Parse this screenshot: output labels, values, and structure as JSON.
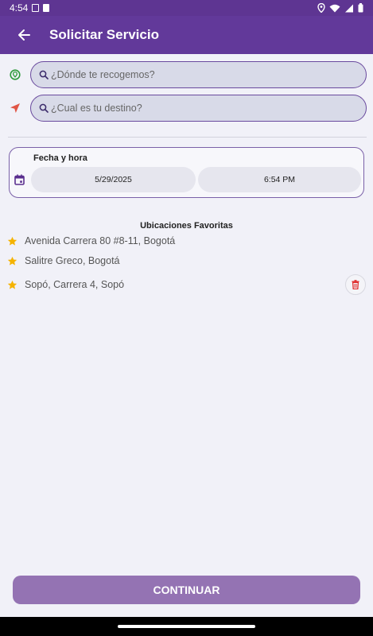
{
  "status_bar": {
    "time": "4:54",
    "icons": [
      "screenshot-icon",
      "sd-card-icon",
      "location-icon",
      "wifi-icon",
      "signal-icon",
      "battery-icon"
    ]
  },
  "app_bar": {
    "title": "Solicitar Servicio",
    "back_icon": "arrow-back-icon"
  },
  "pickup": {
    "placeholder": "¿Dónde te recogemos?",
    "icon": "location-pin-icon",
    "icon_color": "#2e9a3a"
  },
  "destination": {
    "placeholder": "¿Cual es tu destino?",
    "icon": "navigation-arrow-icon",
    "icon_color": "#e05545"
  },
  "schedule": {
    "label": "Fecha y hora",
    "date": "5/29/2025",
    "time": "6:54 PM",
    "icon": "calendar-icon"
  },
  "favorites": {
    "title": "Ubicaciones Favoritas",
    "star_color": "#f5b300",
    "items": [
      {
        "label": "Avenida Carrera 80 #8-11, Bogotá"
      },
      {
        "label": "Salitre Greco, Bogotá"
      },
      {
        "label": "Sopó, Carrera 4, Sopó"
      }
    ],
    "delete_icon": "trash-icon",
    "delete_color": "#e03030"
  },
  "continue_button": {
    "label": "CONTINUAR"
  },
  "colors": {
    "primary": "#62399a",
    "button": "#9473b3",
    "background": "#f1f1f8"
  }
}
